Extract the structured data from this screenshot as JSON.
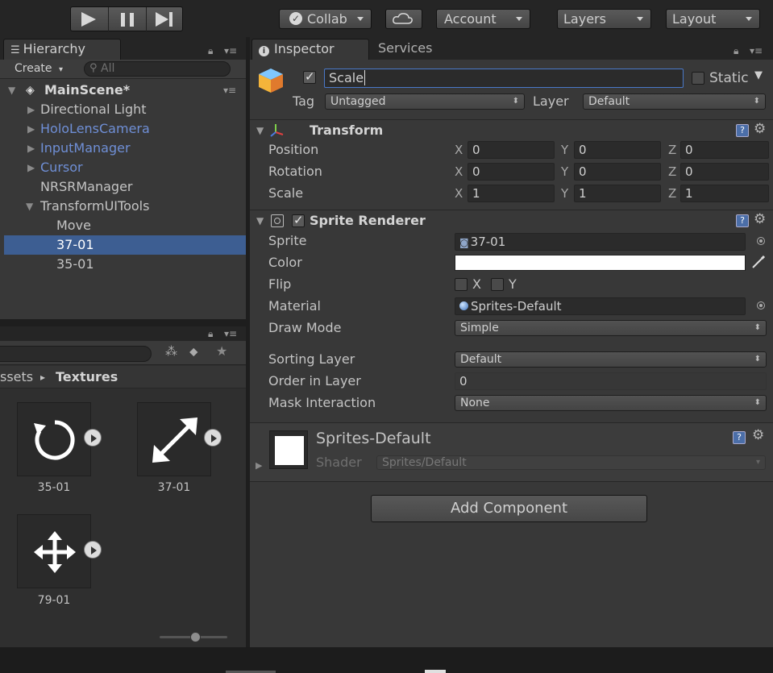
{
  "toolbar": {
    "collab_label": "Collab",
    "account_label": "Account",
    "layers_label": "Layers",
    "layout_label": "Layout"
  },
  "hierarchy": {
    "tab_label": "Hierarchy",
    "create_label": "Create",
    "search_placeholder": "All",
    "scene_name": "MainScene*",
    "items": [
      {
        "label": "Directional Light",
        "prefab": false
      },
      {
        "label": "HoloLensCamera",
        "prefab": true
      },
      {
        "label": "InputManager",
        "prefab": true
      },
      {
        "label": "Cursor",
        "prefab": true
      },
      {
        "label": "NRSRManager",
        "prefab": false
      },
      {
        "label": "TransformUITools",
        "prefab": false
      },
      {
        "label": "Move",
        "prefab": false
      },
      {
        "label": "37-01",
        "prefab": false,
        "selected": true
      },
      {
        "label": "35-01",
        "prefab": false
      }
    ]
  },
  "project": {
    "breadcrumb_root": "ssets",
    "breadcrumb_sep": "▸",
    "breadcrumb_folder": "Textures",
    "assets": [
      {
        "label": "35-01",
        "icon": "rotate-icon"
      },
      {
        "label": "37-01",
        "icon": "scale-arrows-icon"
      },
      {
        "label": "79-01",
        "icon": "move-arrows-icon"
      }
    ]
  },
  "inspector": {
    "tab_label": "Inspector",
    "services_label": "Services",
    "object_name": "Scale",
    "static_label": "Static",
    "tag_label": "Tag",
    "tag_value": "Untagged",
    "layer_label": "Layer",
    "layer_value": "Default",
    "transform": {
      "title": "Transform",
      "rows": [
        {
          "label": "Position",
          "x": "0",
          "y": "0",
          "z": "0"
        },
        {
          "label": "Rotation",
          "x": "0",
          "y": "0",
          "z": "0"
        },
        {
          "label": "Scale",
          "x": "1",
          "y": "1",
          "z": "1"
        }
      ]
    },
    "sprite_renderer": {
      "title": "Sprite Renderer",
      "sprite_label": "Sprite",
      "sprite_value": "37-01",
      "color_label": "Color",
      "color_value": "#ffffff",
      "flip_label": "Flip",
      "flip_x": "X",
      "flip_y": "Y",
      "material_label": "Material",
      "material_value": "Sprites-Default",
      "draw_mode_label": "Draw Mode",
      "draw_mode_value": "Simple",
      "sorting_layer_label": "Sorting Layer",
      "sorting_layer_value": "Default",
      "order_label": "Order in Layer",
      "order_value": "0",
      "mask_label": "Mask Interaction",
      "mask_value": "None"
    },
    "material": {
      "name": "Sprites-Default",
      "shader_label": "Shader",
      "shader_value": "Sprites/Default"
    },
    "add_component_label": "Add Component"
  }
}
